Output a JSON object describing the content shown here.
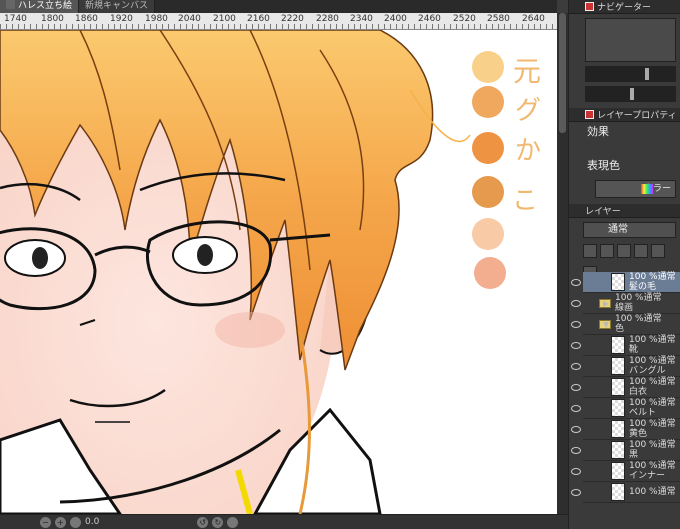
{
  "tabs": [
    {
      "label": "ハレス立ち絵",
      "active": true
    },
    {
      "label": "新規キャンバス",
      "active": false
    }
  ],
  "ruler": {
    "labels": [
      "1740",
      "1800",
      "1860",
      "1920",
      "1980",
      "2040",
      "2100",
      "2160",
      "2220",
      "2280",
      "2340",
      "2400",
      "2460",
      "2520",
      "2580",
      "2640"
    ]
  },
  "canvas": {
    "palette_colors": [
      "#f9d08a",
      "#f0a85e",
      "#ee9342",
      "#e59a4d",
      "#f9caa6",
      "#f2ae8e"
    ],
    "handwritten_notes": [
      "元",
      "グ",
      "か",
      "こ"
    ]
  },
  "statusbar": {
    "zoom_text": "0.0"
  },
  "panel": {
    "navigator_title": "ナビゲーター",
    "layer_property_title": "レイヤープロパティ",
    "effect_label": "効果",
    "expression_color_label": "表現色",
    "color_button": "カラー",
    "layer_panel_title": "レイヤー",
    "blend_mode": "通常",
    "layers": [
      {
        "opacity": "100 %通常",
        "name": "髪の毛",
        "type": "raster",
        "selected": true,
        "indent": 0
      },
      {
        "opacity": "100 %通常",
        "name": "線画",
        "type": "folder",
        "selected": false,
        "indent": 0,
        "expanded": false
      },
      {
        "opacity": "100 %通常",
        "name": "色",
        "type": "folder",
        "selected": false,
        "indent": 0,
        "expanded": true
      },
      {
        "opacity": "100 %通常",
        "name": "靴",
        "type": "raster",
        "selected": false,
        "indent": 1
      },
      {
        "opacity": "100 %通常",
        "name": "バングル",
        "type": "raster",
        "selected": false,
        "indent": 1
      },
      {
        "opacity": "100 %通常",
        "name": "白衣",
        "type": "raster",
        "selected": false,
        "indent": 1
      },
      {
        "opacity": "100 %通常",
        "name": "ベルト",
        "type": "raster",
        "selected": false,
        "indent": 1
      },
      {
        "opacity": "100 %通常",
        "name": "黄色",
        "type": "raster",
        "selected": false,
        "indent": 1
      },
      {
        "opacity": "100 %通常",
        "name": "黒",
        "type": "raster",
        "selected": false,
        "indent": 1
      },
      {
        "opacity": "100 %通常",
        "name": "インナー",
        "type": "raster",
        "selected": false,
        "indent": 1
      },
      {
        "opacity": "100 %通常",
        "name": "",
        "type": "raster",
        "selected": false,
        "indent": 1
      }
    ]
  }
}
